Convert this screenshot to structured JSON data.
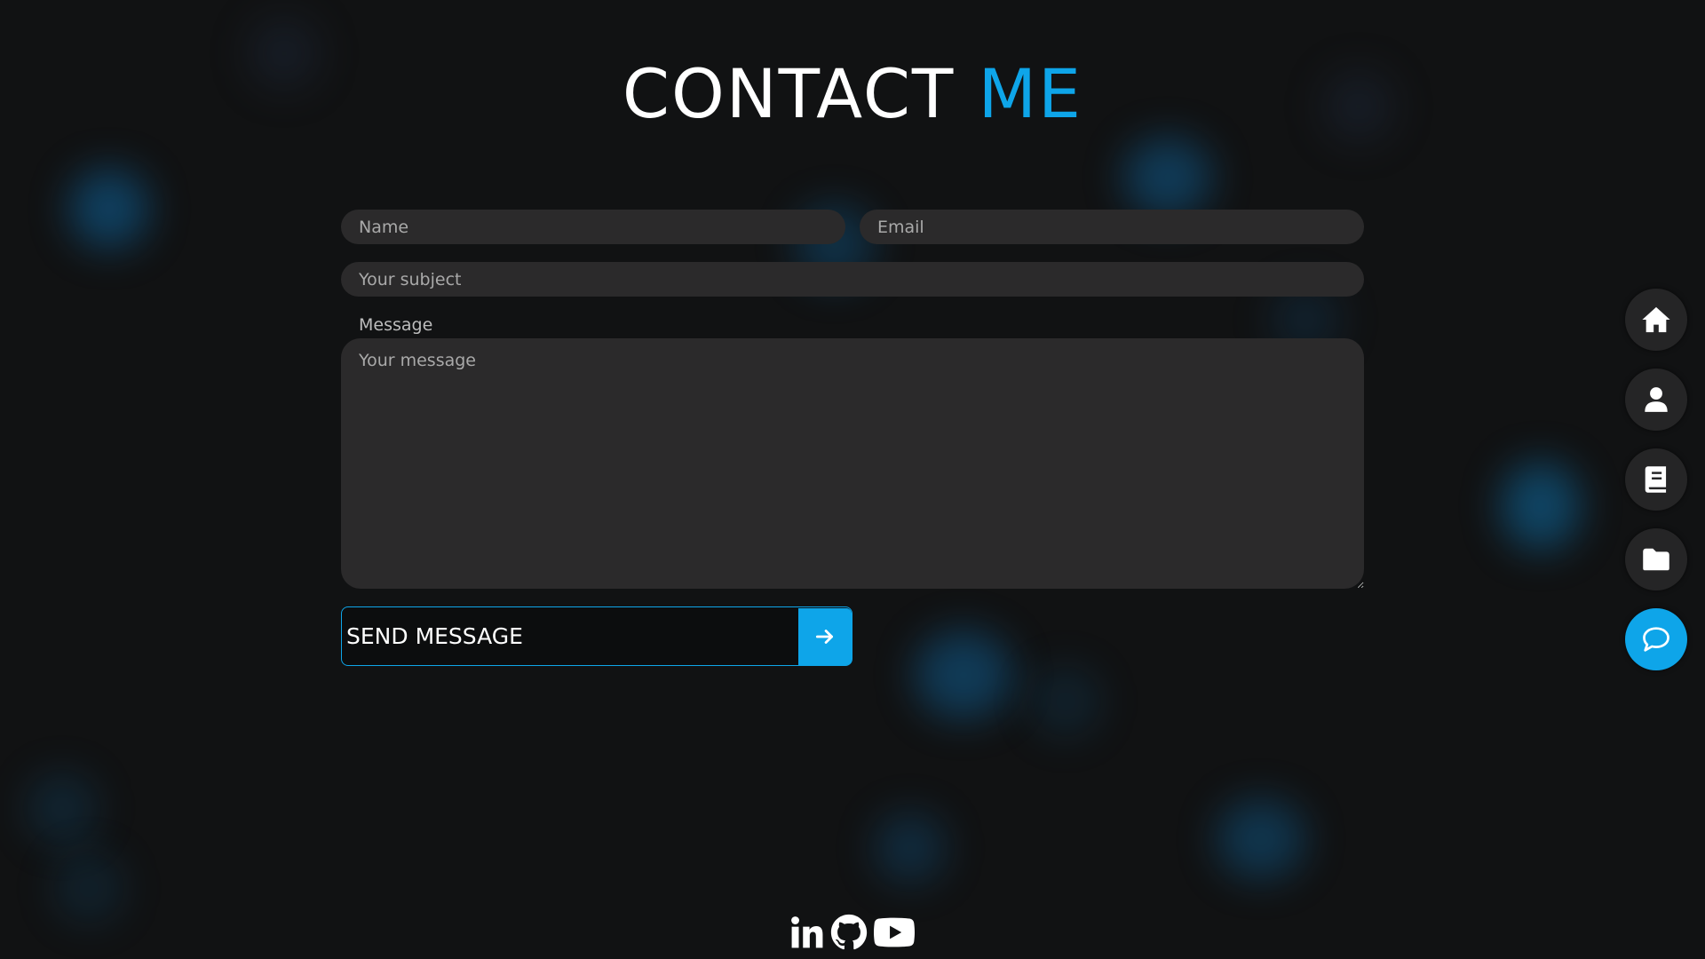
{
  "colors": {
    "background": "#111213",
    "accent": "#0ea5e9",
    "field_bg": "#2b2a2b",
    "nav_bg": "#252526",
    "text": "#ffffff"
  },
  "header": {
    "title_main": "CONTACT ",
    "title_accent": "ME"
  },
  "form": {
    "name_placeholder": "Name",
    "email_placeholder": "Email",
    "subject_placeholder": "Your subject",
    "message_label": "Message",
    "message_placeholder": "Your message",
    "send_label": "SEND MESSAGE",
    "send_icon": "arrow-right-icon"
  },
  "side_nav": {
    "items": [
      {
        "icon": "home-icon",
        "active": false
      },
      {
        "icon": "user-icon",
        "active": false
      },
      {
        "icon": "book-icon",
        "active": false
      },
      {
        "icon": "folder-icon",
        "active": false
      },
      {
        "icon": "chat-icon",
        "active": true
      }
    ]
  },
  "socials": {
    "items": [
      {
        "icon": "linkedin-icon"
      },
      {
        "icon": "github-icon"
      },
      {
        "icon": "youtube-icon"
      }
    ]
  }
}
